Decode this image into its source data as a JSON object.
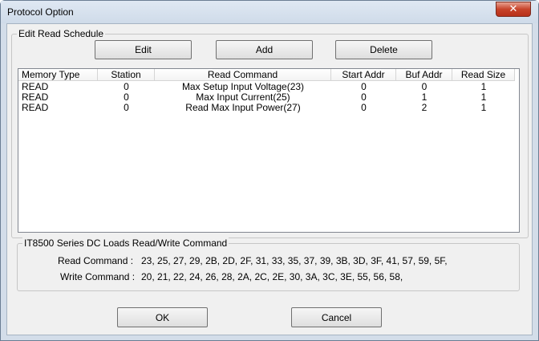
{
  "window": {
    "title": "Protocol Option",
    "close_glyph": "✕"
  },
  "schedule": {
    "group_label": "Edit Read Schedule",
    "buttons": {
      "edit": "Edit",
      "add": "Add",
      "delete": "Delete"
    },
    "columns": [
      "Memory Type",
      "Station",
      "Read Command",
      "Start Addr",
      "Buf Addr",
      "Read Size"
    ],
    "rows": [
      [
        "READ",
        "0",
        "Max Setup Input Voltage(23)",
        "0",
        "0",
        "1"
      ],
      [
        "READ",
        "0",
        "Max Input Current(25)",
        "0",
        "1",
        "1"
      ],
      [
        "READ",
        "0",
        "Read Max Input Power(27)",
        "0",
        "2",
        "1"
      ]
    ]
  },
  "commands": {
    "group_label": "IT8500 Series DC Loads Read/Write Command",
    "read_label": "Read Command :",
    "read_values": "23, 25, 27, 29, 2B, 2D, 2F, 31, 33, 35, 37, 39, 3B, 3D, 3F, 41, 57, 59, 5F,",
    "write_label": "Write Command :",
    "write_values": "20, 21, 22, 24, 26, 28, 2A, 2C, 2E, 30, 3A, 3C, 3E, 55, 56, 58,"
  },
  "footer": {
    "ok": "OK",
    "cancel": "Cancel"
  }
}
